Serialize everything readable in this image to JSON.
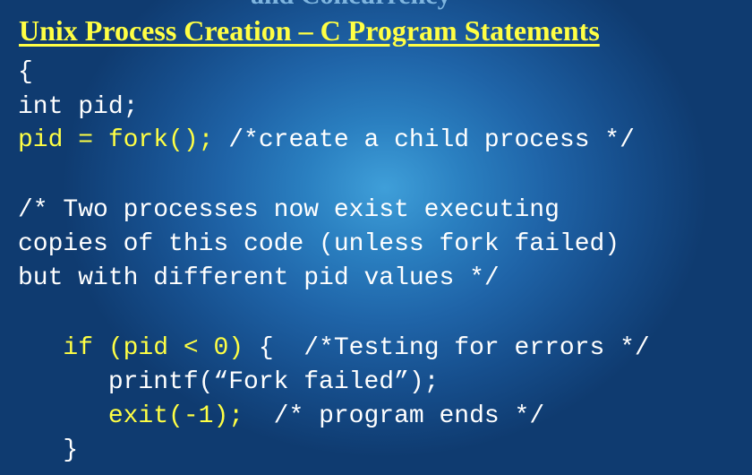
{
  "slide": {
    "top_fragment": "and Concurrency",
    "title": "Unix Process Creation – C Program Statements",
    "colors": {
      "title": "#ffff44",
      "code_highlight": "#ffff44",
      "code_default": "#ffffff",
      "background_center": "#3f9fd9",
      "background_edge": "#0f3b70"
    }
  },
  "code": {
    "l1": "{",
    "l2": "int pid;",
    "l3_stmt": "pid = fork();",
    "l3_comment": " /*create a child process */",
    "l5": "/* Two processes now exist executing",
    "l6": "copies of this code (unless fork failed)",
    "l7": "but with different pid values */",
    "l9_indent": "   ",
    "l9_stmt": "if (pid < 0)",
    "l9_rest": " {  /*Testing for errors */",
    "l10": "      printf(“Fork failed”);",
    "l11_indent": "      ",
    "l11_stmt": "exit(-1);",
    "l11_comment": "  /* program ends */",
    "l12": "   }"
  }
}
